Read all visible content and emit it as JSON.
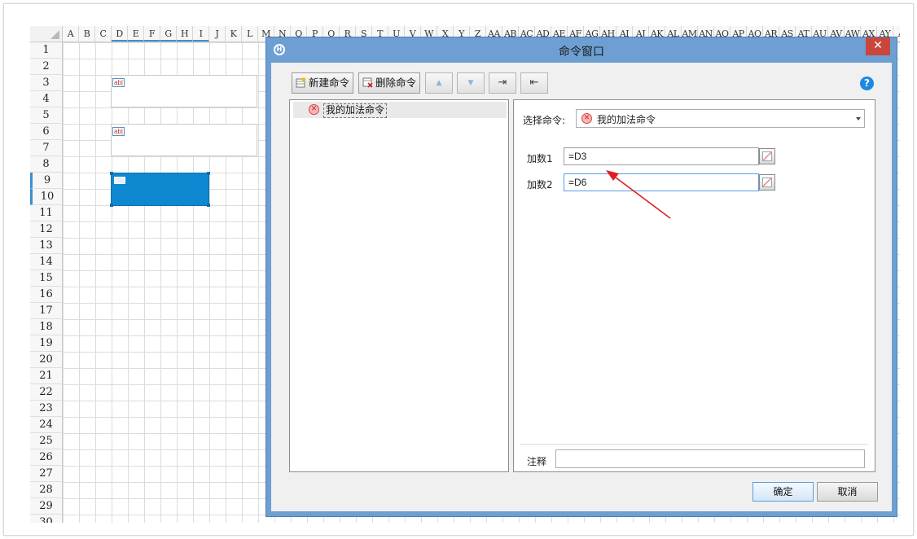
{
  "spreadsheet": {
    "columns": [
      "A",
      "B",
      "C",
      "D",
      "E",
      "F",
      "G",
      "H",
      "I",
      "J",
      "K",
      "L",
      "M",
      "N",
      "O",
      "P",
      "Q",
      "R",
      "S",
      "T",
      "U",
      "V",
      "W",
      "X",
      "Y",
      "Z",
      "AA",
      "AB",
      "AC",
      "AD",
      "AE",
      "AF",
      "AG",
      "AH",
      "AI",
      "AJ",
      "AK",
      "AL",
      "AM",
      "AN",
      "AO",
      "AP",
      "AQ",
      "AR",
      "AS",
      "AT",
      "AU",
      "AV",
      "AW",
      "AX",
      "AY",
      "A"
    ],
    "rows": [
      "1",
      "2",
      "3",
      "4",
      "5",
      "6",
      "7",
      "8",
      "9",
      "10",
      "11",
      "12",
      "13",
      "14",
      "15",
      "16",
      "17",
      "18",
      "19",
      "20",
      "21",
      "22",
      "23",
      "24",
      "25",
      "26",
      "27",
      "28",
      "29",
      "30"
    ],
    "textbox_icon_label": "ab|"
  },
  "dialog": {
    "title": "命令窗口",
    "close_symbol": "✕",
    "logo_letter": "H",
    "toolbar": {
      "new_command": "新建命令",
      "delete_command": "删除命令",
      "move_up_symbol": "▲",
      "move_down_symbol": "▼",
      "indent_symbol": "⇥",
      "outdent_symbol": "⇤"
    },
    "help_symbol": "?",
    "command_list": [
      {
        "label": "我的加法命令"
      }
    ],
    "select_label": "选择命令:",
    "selected_command": "我的加法命令",
    "params": [
      {
        "label": "加数1",
        "value": "=D3"
      },
      {
        "label": "加数2",
        "value": "=D6"
      }
    ],
    "note_label": "注释",
    "note_value": "",
    "ok_label": "确定",
    "cancel_label": "取消"
  },
  "colors": {
    "dialog_frame": "#6d9fd2",
    "selection_blue": "#0f88d2",
    "arrow_red": "#e02020",
    "close_red": "#c9463d"
  }
}
